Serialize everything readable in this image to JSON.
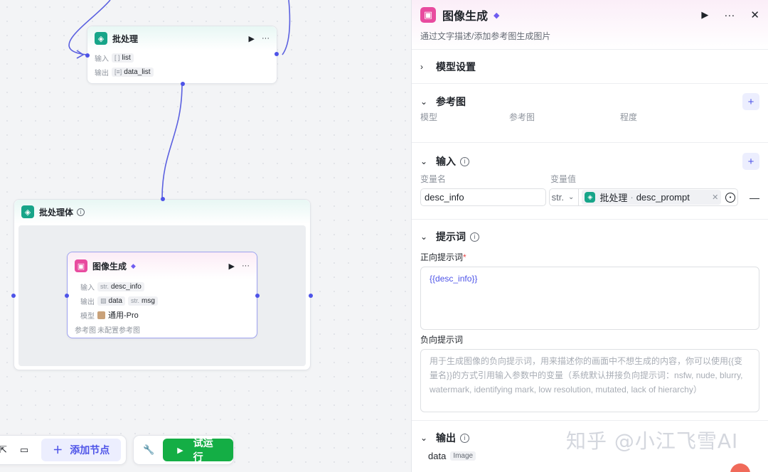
{
  "canvas": {
    "batch_node": {
      "title": "批处理",
      "input_key": "输入",
      "input_chip": "list",
      "input_tag": "[ ]",
      "output_key": "输出",
      "output_chip": "data_list",
      "output_tag": "[≡]"
    },
    "batch_body": {
      "title": "批处理体"
    },
    "image_node": {
      "title": "图像生成",
      "input_key": "输入",
      "input_chip": "desc_info",
      "input_tag": "str.",
      "output_key": "输出",
      "output_chip1": "data",
      "output_chip2": "msg",
      "output_tag2": "str.",
      "model_key": "模型",
      "model_value": "通用-Pro",
      "ref_key": "参考图",
      "ref_value": "未配置参考图"
    }
  },
  "toolbar": {
    "add_node_label": "添加节点",
    "run_label": "试运行"
  },
  "panel": {
    "title": "图像生成",
    "description": "通过文字描述/添加参考图生成图片",
    "model_settings": "模型设置",
    "reference": {
      "title": "参考图",
      "col_model": "模型",
      "col_ref": "参考图",
      "col_degree": "程度"
    },
    "input": {
      "title": "输入",
      "col_name": "变量名",
      "col_value": "变量值",
      "var_name": "desc_info",
      "type": "str.",
      "ref_node": "批处理",
      "ref_sep": "·",
      "ref_field": "desc_prompt"
    },
    "prompt": {
      "title": "提示词",
      "positive_label": "正向提示词",
      "required_mark": "*",
      "positive_value": "{{desc_info}}",
      "negative_label": "负向提示词",
      "negative_placeholder": "用于生成图像的负向提示词，用来描述你的画面中不想生成的内容，你可以使用{{变量名}}的方式引用输入参数中的变量（系统默认拼接负向提示词：nsfw, nude, blurry, watermark, identifying mark, low resolution, mutated, lack of hierarchy）"
    },
    "output": {
      "title": "输出",
      "var_name": "data",
      "var_type": "Image"
    }
  },
  "watermark": "知乎 @小江飞雪AI",
  "colors": {
    "accent": "#4d53e8",
    "run_green": "#14ae45",
    "image_node_pink": "#e84b9f",
    "batch_node_teal": "#17a589"
  }
}
